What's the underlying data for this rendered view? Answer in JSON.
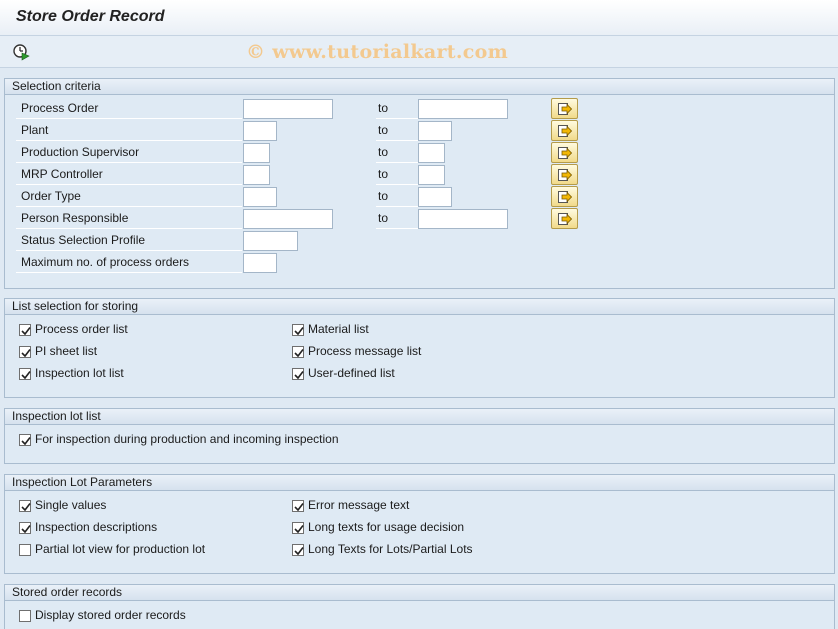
{
  "title": "Store Order Record",
  "watermark": "© www.tutorialkart.com",
  "toolbar": {
    "execute_icon": "clock-execute-icon"
  },
  "selection": {
    "title": "Selection criteria",
    "to_label": "to",
    "rows": [
      {
        "label": "Process Order",
        "from": "",
        "to": ""
      },
      {
        "label": "Plant",
        "from": "",
        "to": ""
      },
      {
        "label": "Production Supervisor",
        "from": "",
        "to": ""
      },
      {
        "label": "MRP Controller",
        "from": "",
        "to": ""
      },
      {
        "label": "Order Type",
        "from": "",
        "to": ""
      },
      {
        "label": "Person Responsible",
        "from": "",
        "to": ""
      },
      {
        "label": "Status Selection Profile",
        "value": ""
      },
      {
        "label": "Maximum no. of process orders",
        "value": ""
      }
    ],
    "button_icon": "multiple-selection-arrow-icon"
  },
  "list_selection": {
    "title": "List selection for storing",
    "items": [
      {
        "label": "Process order list",
        "checked": true
      },
      {
        "label": "Material list",
        "checked": true
      },
      {
        "label": "PI sheet list",
        "checked": true
      },
      {
        "label": "Process message list",
        "checked": true
      },
      {
        "label": "Inspection lot list",
        "checked": true
      },
      {
        "label": "User-defined list",
        "checked": true
      }
    ]
  },
  "inspection_lot_list": {
    "title": "Inspection lot list",
    "items": [
      {
        "label": "For inspection during production and incoming inspection",
        "checked": true
      }
    ]
  },
  "inspection_lot_params": {
    "title": "Inspection Lot Parameters",
    "items": [
      {
        "label": "Single values",
        "checked": true
      },
      {
        "label": "Error message text",
        "checked": true
      },
      {
        "label": "Inspection descriptions",
        "checked": true
      },
      {
        "label": "Long texts for usage decision",
        "checked": true
      },
      {
        "label": "Partial lot view for production lot",
        "checked": false
      },
      {
        "label": "Long Texts for Lots/Partial Lots",
        "checked": true
      }
    ]
  },
  "stored_records": {
    "title": "Stored order records",
    "items": [
      {
        "label": "Display stored order records",
        "checked": false
      }
    ]
  },
  "colors": {
    "background": "#dfe9f3",
    "button": "#f1da8a",
    "border": "#a9bccf"
  }
}
